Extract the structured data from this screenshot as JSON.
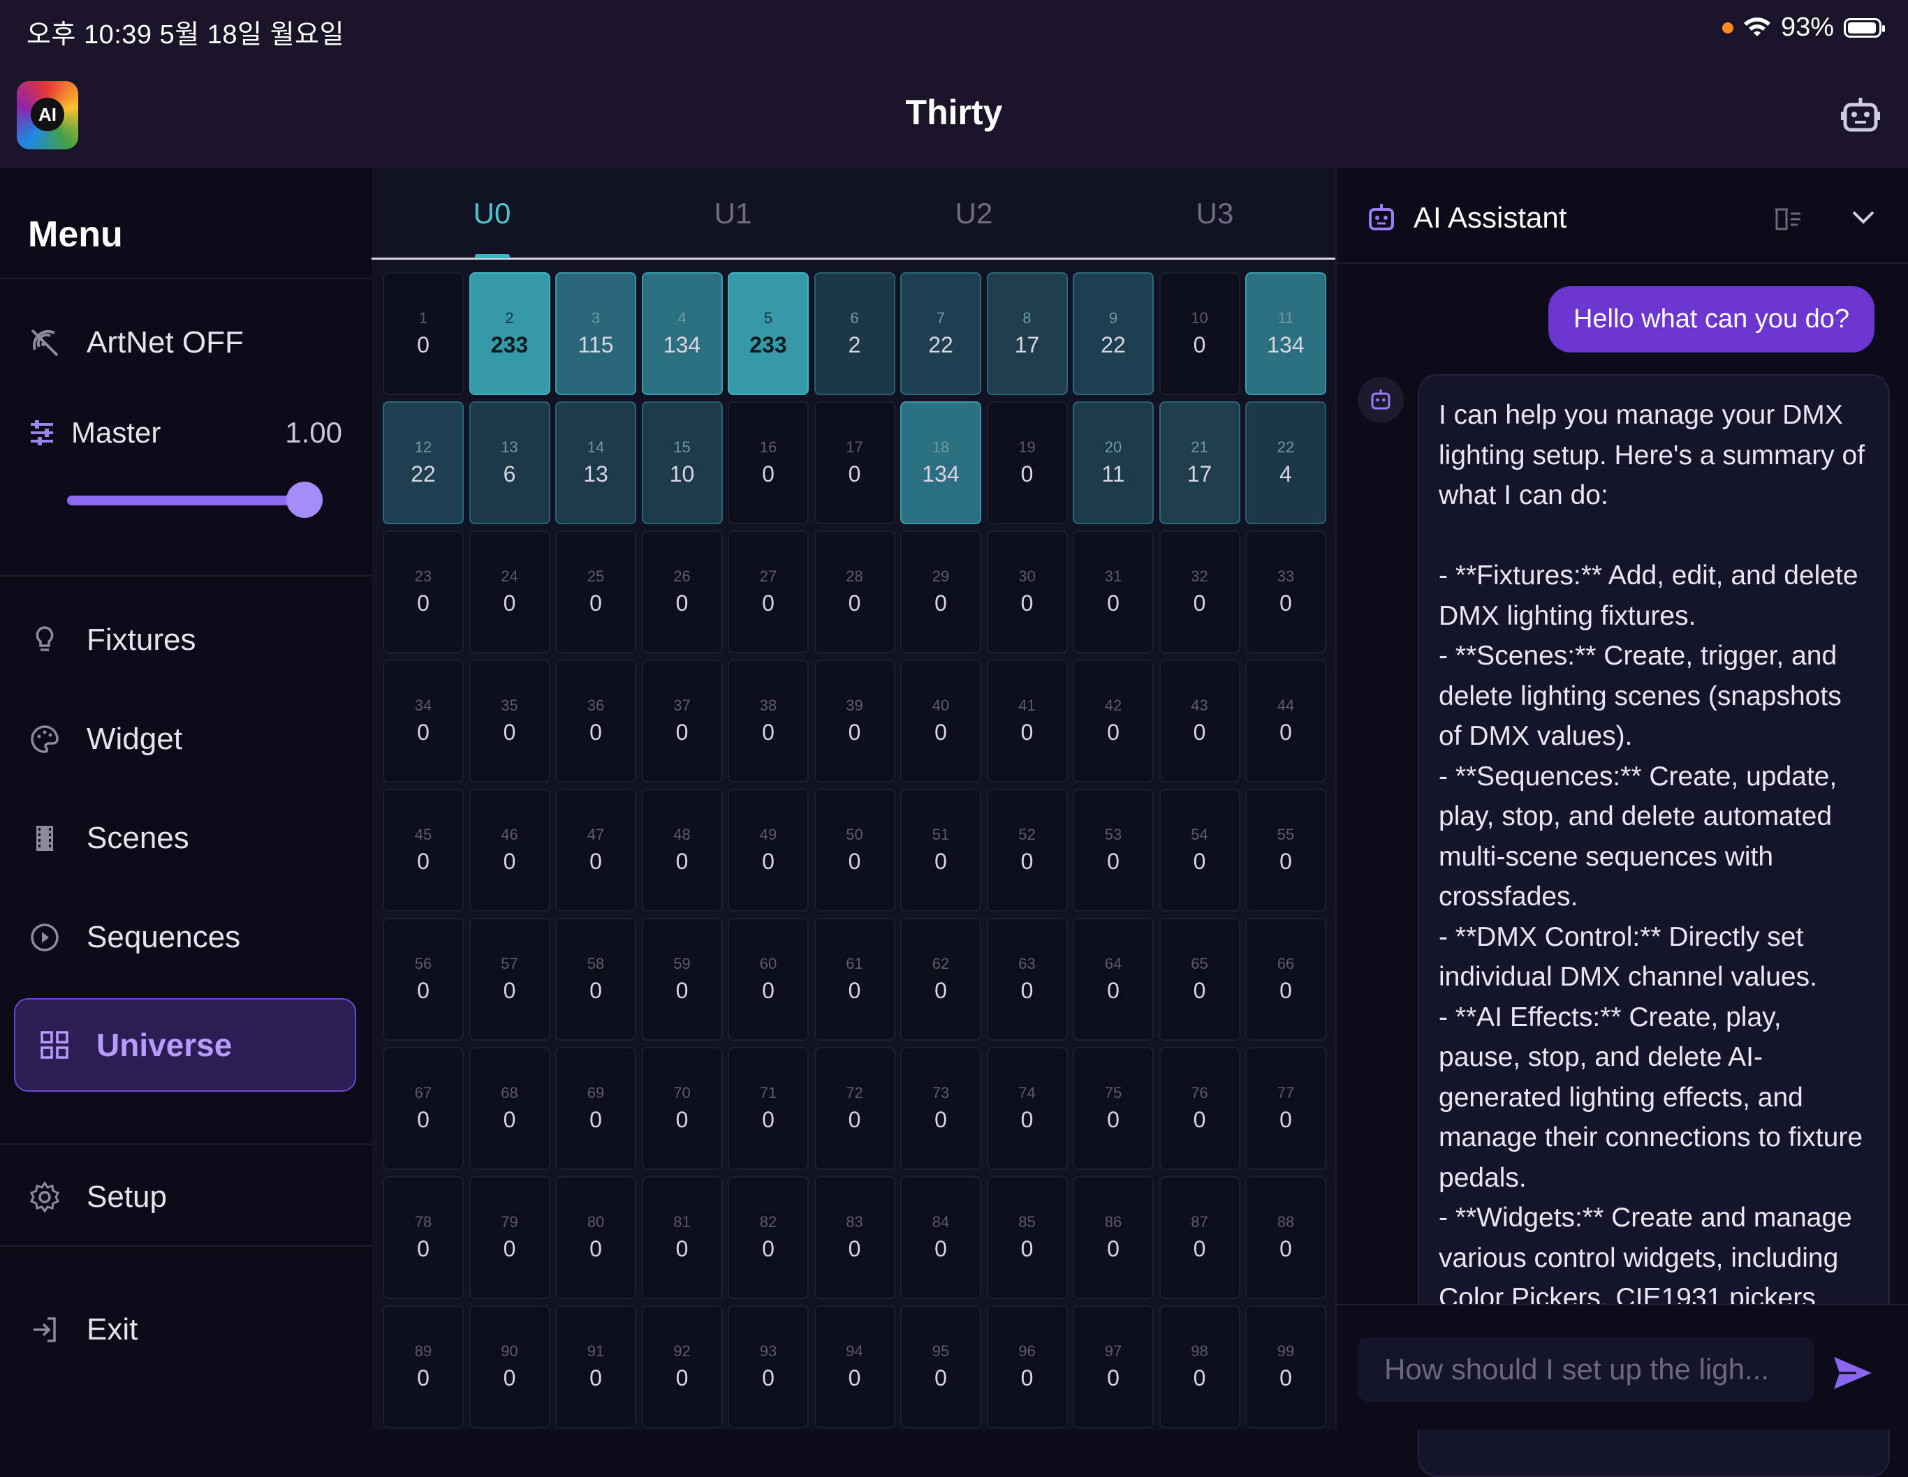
{
  "status": {
    "time_date": "오후 10:39   5월 18일 월요일",
    "battery": "93%"
  },
  "app": {
    "title": "Thirty",
    "logo_text": "AI"
  },
  "sidebar": {
    "title": "Menu",
    "artnet_label": "ArtNet OFF",
    "master": {
      "label": "Master",
      "value": "1.00",
      "level": 1.0
    },
    "items": [
      {
        "label": "Fixtures",
        "icon": "lightbulb-icon"
      },
      {
        "label": "Widget",
        "icon": "palette-icon"
      },
      {
        "label": "Scenes",
        "icon": "film-icon"
      },
      {
        "label": "Sequences",
        "icon": "play-circle-icon"
      },
      {
        "label": "Universe",
        "icon": "grid-icon"
      },
      {
        "label": "Setup",
        "icon": "gear-icon"
      },
      {
        "label": "Exit",
        "icon": "exit-icon"
      }
    ]
  },
  "universe": {
    "tabs": [
      "U0",
      "U1",
      "U2",
      "U3"
    ],
    "active_tab": "U0",
    "accent": "#3db4c4",
    "values": [
      0,
      233,
      115,
      134,
      233,
      2,
      22,
      17,
      22,
      0,
      134,
      22,
      6,
      13,
      10,
      0,
      0,
      134,
      0,
      11,
      17,
      4
    ]
  },
  "assistant": {
    "title": "AI Assistant",
    "user_message": "Hello what can you do?",
    "bot_message": "I can help you manage your DMX lighting setup. Here's a summary of what I can do:\n\n- **Fixtures:** Add, edit, and delete DMX lighting fixtures.\n- **Scenes:** Create, trigger, and delete lighting scenes (snapshots of DMX values).\n- **Sequences:** Create, update, play, stop, and delete automated multi-scene sequences with crossfades.\n- **DMX Control:** Directly set individual DMX channel values.\n- **AI Effects:** Create, play, pause, stop, and delete AI-generated lighting effects, and manage their connections to fixture pedals.\n- **Widgets:** Create and manage various control widgets, including Color Pickers, CIE1931 pickers",
    "input_placeholder": "How should I set up the ligh..."
  },
  "colors": {
    "accent_purple": "#6a35d0",
    "accent_teal": "#3db4c4",
    "background": "#0e0c1a"
  }
}
